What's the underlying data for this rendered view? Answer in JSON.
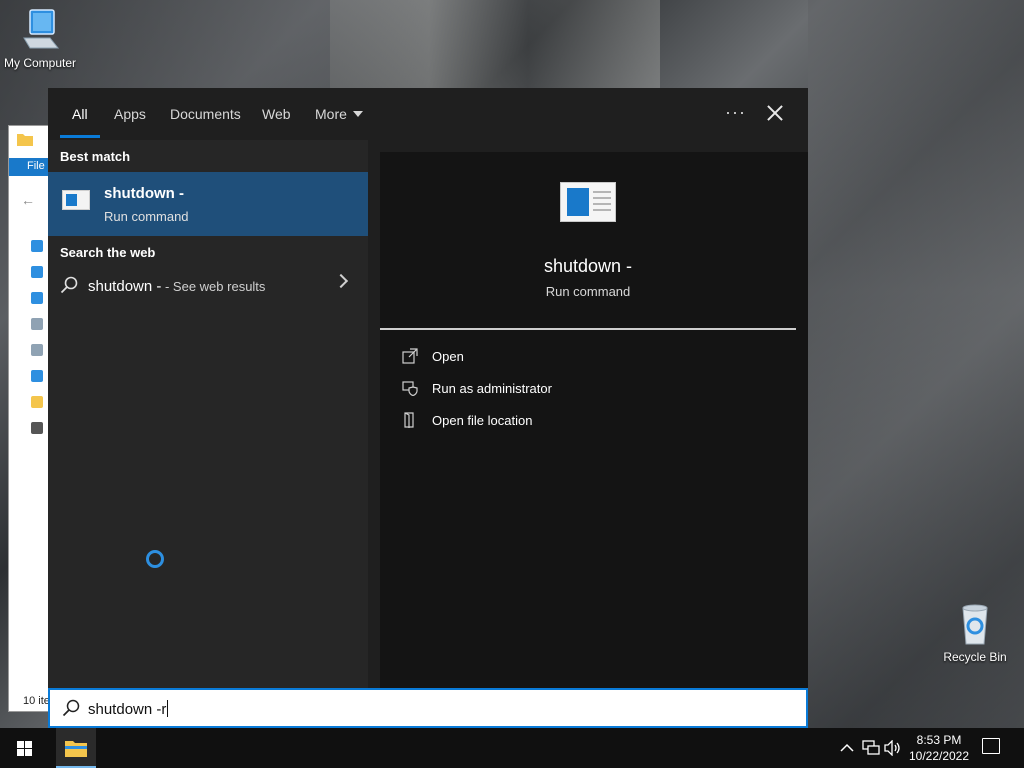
{
  "desktop": {
    "icons": [
      {
        "label": "My Computer"
      },
      {
        "label": "Recycle Bin"
      }
    ]
  },
  "explorer": {
    "ribbon_tab": "File",
    "status_text": "10 ite"
  },
  "search": {
    "tabs": [
      {
        "label": "All",
        "active": true
      },
      {
        "label": "Apps"
      },
      {
        "label": "Documents"
      },
      {
        "label": "Web"
      },
      {
        "label": "More"
      }
    ],
    "options_label": "···",
    "best_match_title": "Best match",
    "best_match": {
      "title": "shutdown -",
      "subtitle": "Run command"
    },
    "web_section_title": "Search the web",
    "web_result": {
      "term": "shutdown -",
      "suffix": " - See web results"
    },
    "preview": {
      "title": "shutdown -",
      "subtitle": "Run command"
    },
    "actions": [
      {
        "label": "Open",
        "icon": "open-icon"
      },
      {
        "label": "Run as administrator",
        "icon": "shield-icon"
      },
      {
        "label": "Open file location",
        "icon": "file-location-icon"
      }
    ],
    "query": "shutdown -r"
  },
  "taskbar": {
    "time": "8:53 PM",
    "date": "10/22/2022"
  },
  "colors": {
    "accent": "#0a7bd8",
    "selection": "#1f4f7a",
    "panel_bg": "#1f1f1f"
  }
}
